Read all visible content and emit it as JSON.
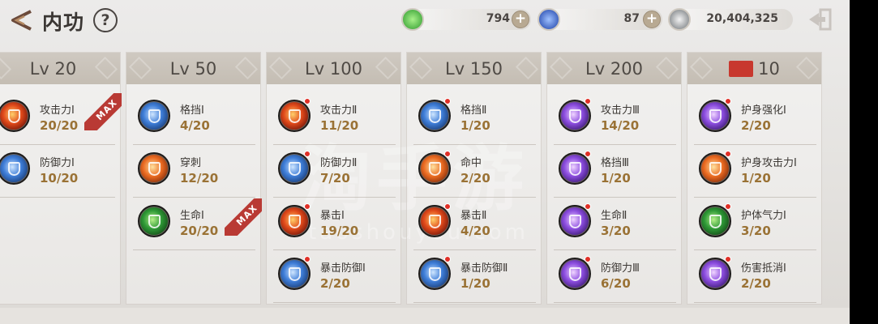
{
  "header": {
    "title": "内功",
    "help_label": "?"
  },
  "currencies": [
    {
      "name": "green-currency",
      "value": "794",
      "color": "#52b64a"
    },
    {
      "name": "blue-currency",
      "value": "87",
      "color": "#2b5ed1"
    },
    {
      "name": "silver-currency",
      "value": "20,404,325",
      "color": "#8a8f94"
    }
  ],
  "columns": [
    {
      "label": "Lv 20",
      "skills": [
        {
          "name": "攻击力Ⅰ",
          "level": "20/20",
          "icon": "sword-icon",
          "style": "fire",
          "dot": false
        },
        {
          "name": "防御力Ⅰ",
          "level": "10/20",
          "icon": "shield-icon",
          "style": "blue",
          "dot": false
        }
      ],
      "max_label": "MAX"
    },
    {
      "label": "Lv 50",
      "skills": [
        {
          "name": "格挡Ⅰ",
          "level": "4/20",
          "icon": "shield-icon",
          "style": "blue",
          "dot": false
        },
        {
          "name": "穿刺",
          "level": "12/20",
          "icon": "pierce-icon",
          "style": "orange",
          "dot": false
        },
        {
          "name": "生命Ⅰ",
          "level": "20/20",
          "icon": "sprout-icon",
          "style": "green",
          "dot": false
        }
      ],
      "max_label": "MAX"
    },
    {
      "label": "Lv 100",
      "skills": [
        {
          "name": "攻击力Ⅱ",
          "level": "11/20",
          "icon": "sword-icon",
          "style": "fire",
          "dot": true
        },
        {
          "name": "防御力Ⅱ",
          "level": "7/20",
          "icon": "shield-icon",
          "style": "blue",
          "dot": true
        },
        {
          "name": "暴击Ⅰ",
          "level": "19/20",
          "icon": "burst-icon",
          "style": "fire",
          "dot": true
        },
        {
          "name": "暴击防御Ⅰ",
          "level": "2/20",
          "icon": "shield-icon",
          "style": "blue",
          "dot": true
        }
      ]
    },
    {
      "label": "Lv 150",
      "skills": [
        {
          "name": "格挡Ⅱ",
          "level": "1/20",
          "icon": "shield-icon",
          "style": "blue",
          "dot": true
        },
        {
          "name": "命中",
          "level": "2/20",
          "icon": "target-icon",
          "style": "orange",
          "dot": true
        },
        {
          "name": "暴击Ⅱ",
          "level": "4/20",
          "icon": "burst-icon",
          "style": "fire",
          "dot": true
        },
        {
          "name": "暴击防御Ⅱ",
          "level": "1/20",
          "icon": "shield-icon",
          "style": "blue",
          "dot": true
        }
      ]
    },
    {
      "label": "Lv 200",
      "skills": [
        {
          "name": "攻击力Ⅲ",
          "level": "14/20",
          "icon": "sword-icon",
          "style": "purple",
          "dot": true
        },
        {
          "name": "格挡Ⅲ",
          "level": "1/20",
          "icon": "shield-icon",
          "style": "purple",
          "dot": true
        },
        {
          "name": "生命Ⅱ",
          "level": "3/20",
          "icon": "sprout-icon",
          "style": "purple",
          "dot": true
        },
        {
          "name": "防御力Ⅲ",
          "level": "6/20",
          "icon": "shield-icon",
          "style": "purple",
          "dot": true
        }
      ]
    },
    {
      "label": "10",
      "special": true,
      "skills": [
        {
          "name": "护身强化Ⅰ",
          "level": "2/20",
          "icon": "heart-icon",
          "style": "purple",
          "dot": true
        },
        {
          "name": "护身攻击力Ⅰ",
          "level": "1/20",
          "icon": "crossed-swords-icon",
          "style": "orange",
          "dot": true
        },
        {
          "name": "护体气力Ⅰ",
          "level": "3/20",
          "icon": "heart-icon",
          "style": "green",
          "dot": true
        },
        {
          "name": "伤害抵消Ⅰ",
          "level": "2/20",
          "icon": "sword-icon",
          "style": "purple",
          "dot": true
        }
      ]
    }
  ]
}
